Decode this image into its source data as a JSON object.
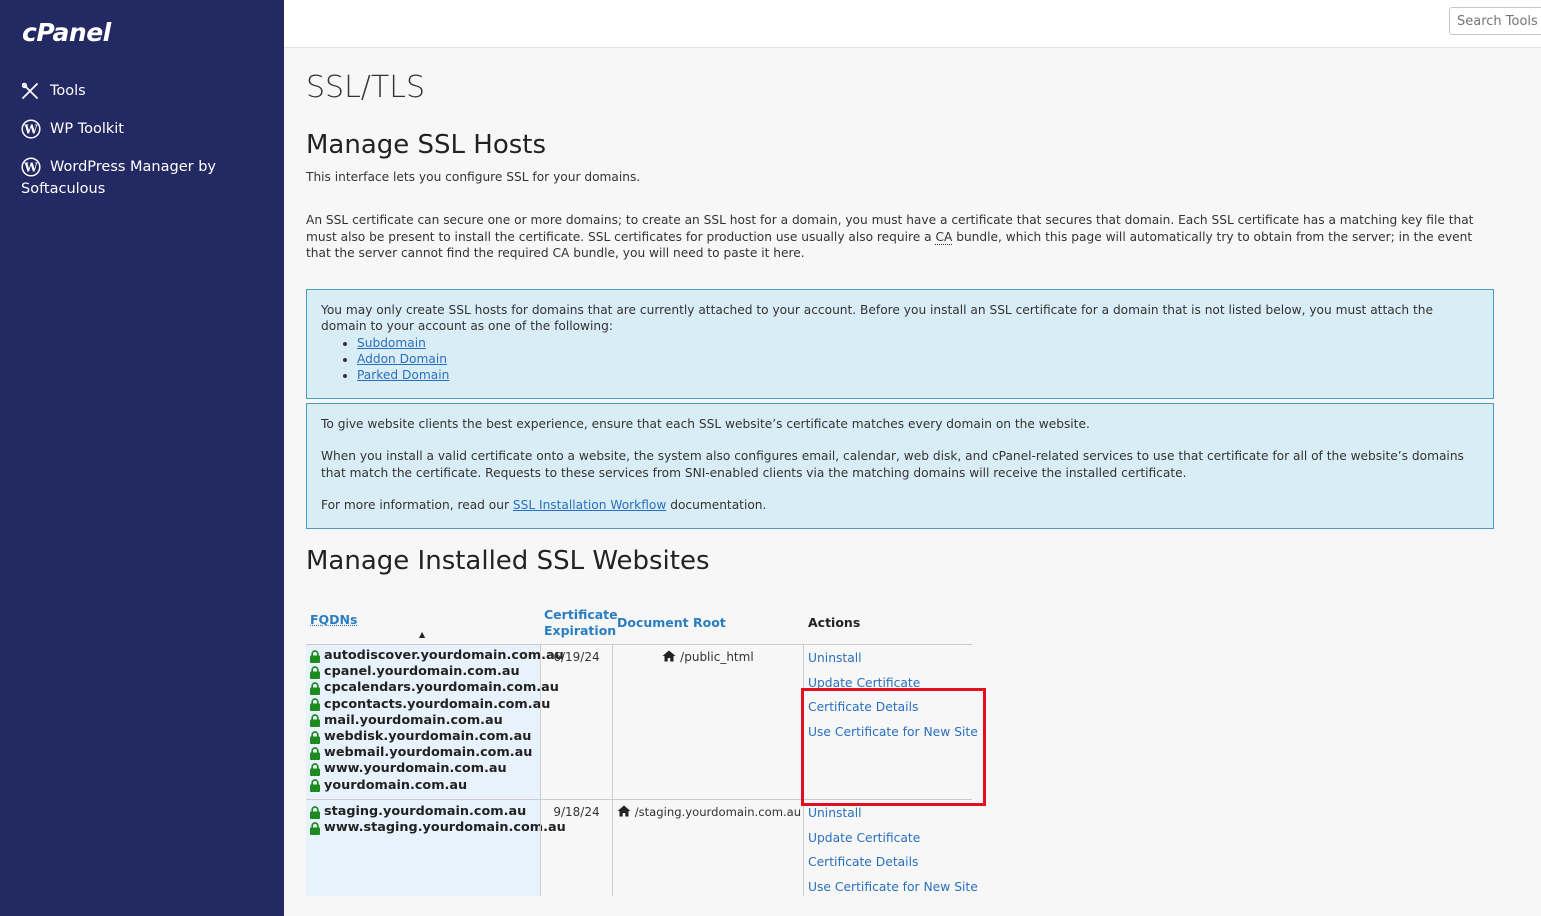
{
  "sidebar": {
    "logo": "cPanel",
    "items": [
      {
        "label": "Tools",
        "icon": "tools-icon"
      },
      {
        "label": "WP Toolkit",
        "icon": "wordpress-icon"
      },
      {
        "label": "WordPress Manager by Softaculous",
        "icon": "wordpress-icon"
      }
    ]
  },
  "topbar": {
    "search_placeholder": "Search Tools"
  },
  "page": {
    "title": "SSL/TLS",
    "manage_hosts": {
      "heading": "Manage SSL Hosts",
      "intro": "This interface lets you configure SSL for your domains.",
      "desc_part1": "An SSL certificate can secure one or more domains; to create an SSL host for a domain, you must have a certificate that secures that domain. Each SSL certificate has a matching key file that must also be present to install the certificate. SSL certificates for production use usually also require a ",
      "desc_abbr": "CA",
      "desc_part2": " bundle, which this page will automatically try to obtain from the server; in the event that the server cannot find the required CA bundle, you will need to paste it here."
    },
    "info1": {
      "text": "You may only create SSL hosts for domains that are currently attached to your account. Before you install an SSL certificate for a domain that is not listed below, you must attach the domain to your account as one of the following:",
      "links": [
        "Subdomain",
        "Addon Domain",
        "Parked Domain"
      ]
    },
    "info2": {
      "p1": "To give website clients the best experience, ensure that each SSL website’s certificate matches every domain on the website.",
      "p2": "When you install a valid certificate onto a website, the system also configures email, calendar, web disk, and cPanel-related services to use that certificate for all of the website’s domains that match the certificate. Requests to these services from SNI-enabled clients via the matching domains will receive the installed certificate.",
      "p3_before": "For more information, read our ",
      "p3_link": "SSL Installation Workflow",
      "p3_after": " documentation."
    },
    "installed": {
      "heading": "Manage Installed SSL Websites",
      "columns": {
        "fqdns": "FQDNs",
        "cert_exp_line1": "Certificate",
        "cert_exp_line2": "Expiration",
        "doc_root": "Document Root",
        "actions": "Actions"
      },
      "sort_indicator": "▲",
      "rows": [
        {
          "fqdns": [
            "autodiscover.yourdomain.com.au",
            "cpanel.yourdomain.com.au",
            "cpcalendars.yourdomain.com.au",
            "cpcontacts.yourdomain.com.au",
            "mail.yourdomain.com.au",
            "webdisk.yourdomain.com.au",
            "webmail.yourdomain.com.au",
            "www.yourdomain.com.au",
            "yourdomain.com.au"
          ],
          "expiration": "6/19/24",
          "doc_root": "/public_html",
          "actions": [
            "Uninstall",
            "Update Certificate",
            "Certificate Details",
            "Use Certificate for New Site"
          ]
        },
        {
          "fqdns": [
            "staging.yourdomain.com.au",
            "www.staging.yourdomain.com.au"
          ],
          "expiration": "9/18/24",
          "doc_root": "/staging.yourdomain.com.au",
          "actions": [
            "Uninstall",
            "Update Certificate",
            "Certificate Details",
            "Use Certificate for New Site"
          ]
        }
      ]
    }
  },
  "colors": {
    "sidebar_bg": "#232a63",
    "link": "#2a6fbf",
    "info_bg": "#d9edf7",
    "lock_green": "#1f8a1f",
    "highlight_red": "#e0101e"
  }
}
